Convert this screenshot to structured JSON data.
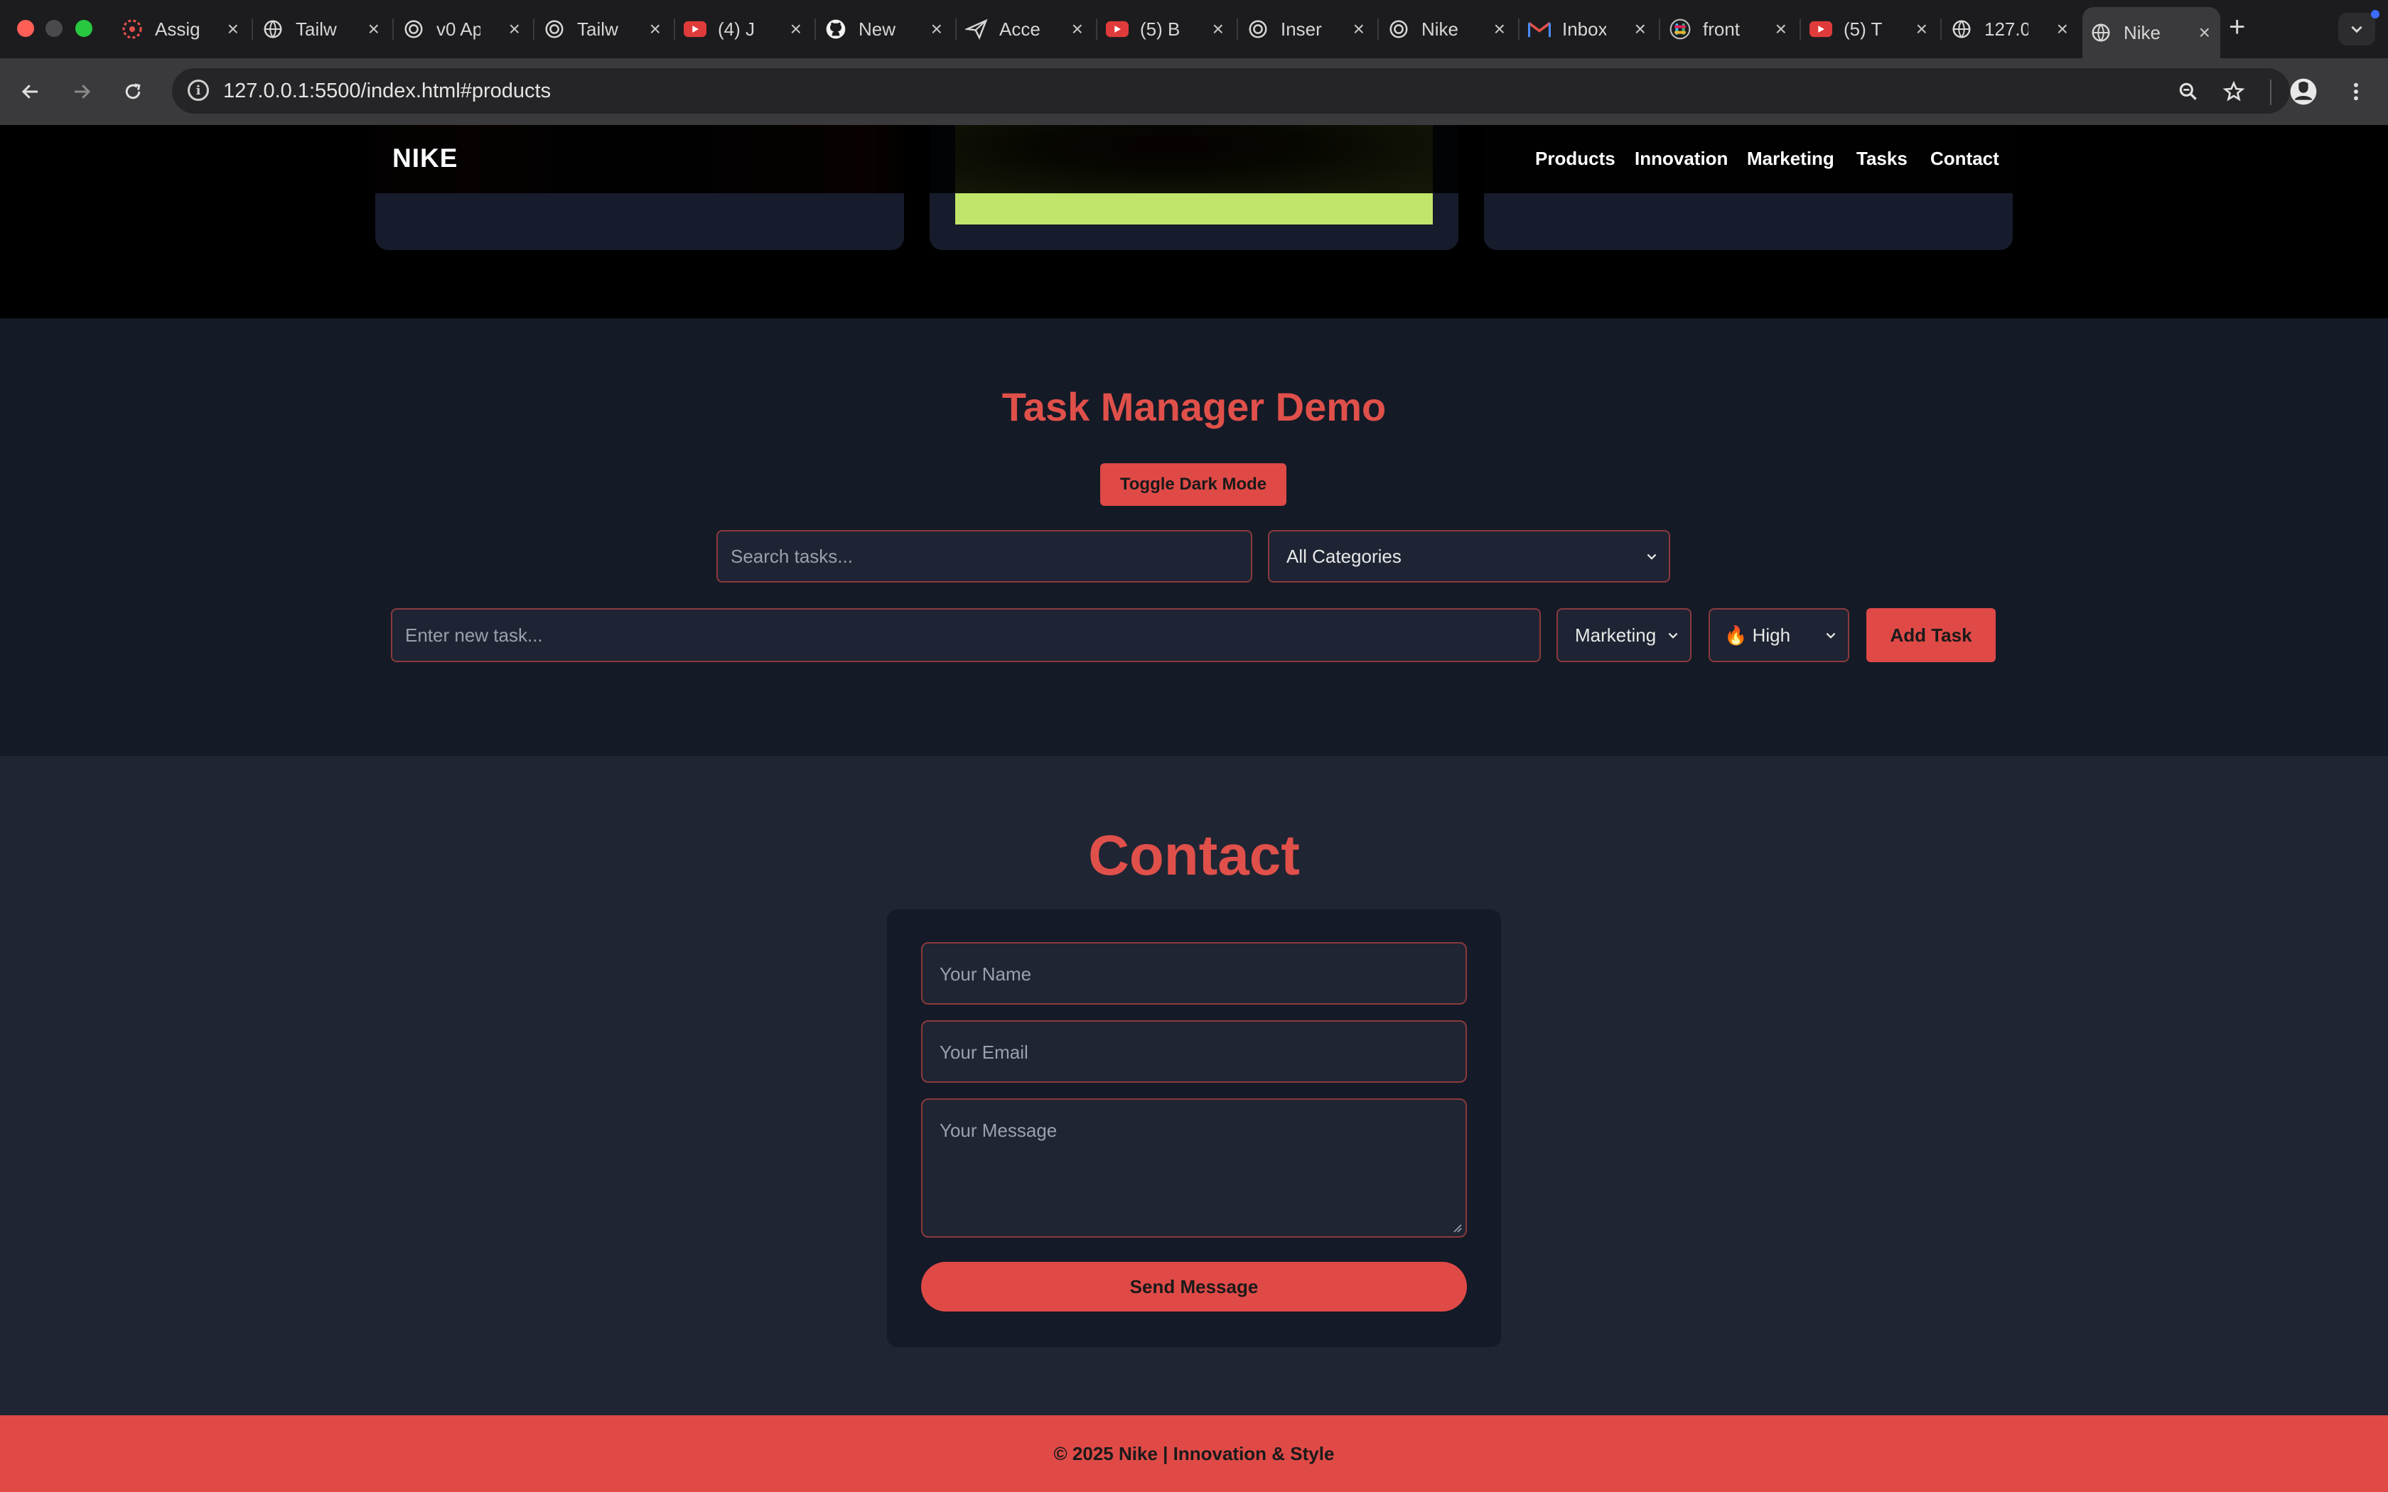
{
  "browser": {
    "tabs": [
      {
        "label": "Assig",
        "icon": "asterisk-icon",
        "color": "#e0504a"
      },
      {
        "label": "Tailw",
        "icon": "globe-icon",
        "color": "#d6d6d6"
      },
      {
        "label": "v0 Ap",
        "icon": "openai-icon",
        "color": "#d6d6d6"
      },
      {
        "label": "Tailw",
        "icon": "openai-icon",
        "color": "#d6d6d6"
      },
      {
        "label": "(4) J",
        "icon": "youtube-icon",
        "color": "#e03b3b"
      },
      {
        "label": "New",
        "icon": "github-icon",
        "color": "#ffffff"
      },
      {
        "label": "Acce",
        "icon": "plane-icon",
        "color": "#d6d6d6"
      },
      {
        "label": "(5) B",
        "icon": "youtube-icon",
        "color": "#e03b3b"
      },
      {
        "label": "Inser",
        "icon": "openai-icon",
        "color": "#d6d6d6"
      },
      {
        "label": "Nike",
        "icon": "openai-icon",
        "color": "#d6d6d6"
      },
      {
        "label": "Inbox",
        "icon": "gmail-icon",
        "color": "#e0504a"
      },
      {
        "label": "front",
        "icon": "slack-icon",
        "color": "#d6d6d6"
      },
      {
        "label": "(5) T",
        "icon": "youtube-icon",
        "color": "#e03b3b"
      },
      {
        "label": "127.0",
        "icon": "globe-icon",
        "color": "#d6d6d6"
      },
      {
        "label": "Nike",
        "icon": "globe-icon",
        "color": "#d6d6d6",
        "active": true
      }
    ],
    "url": "127.0.0.1:5500/index.html#products"
  },
  "nav": {
    "brand": "NIKE",
    "links": [
      "Products",
      "Innovation",
      "Marketing",
      "Tasks",
      "Contact"
    ]
  },
  "tasks": {
    "title": "Task Manager Demo",
    "toggle_label": "Toggle Dark Mode",
    "search_placeholder": "Search tasks...",
    "category_filter": "All Categories",
    "new_task_placeholder": "Enter new task...",
    "category_select": "Marketing",
    "priority_select": "🔥 High",
    "add_label": "Add Task"
  },
  "contact": {
    "title": "Contact",
    "name_placeholder": "Your Name",
    "email_placeholder": "Your Email",
    "message_placeholder": "Your Message",
    "send_label": "Send Message"
  },
  "footer": {
    "text": "© 2025 Nike | Innovation & Style"
  },
  "colors": {
    "accent": "#df4a47",
    "lime": "#c1e46a",
    "page_bg": "#1f2533"
  }
}
